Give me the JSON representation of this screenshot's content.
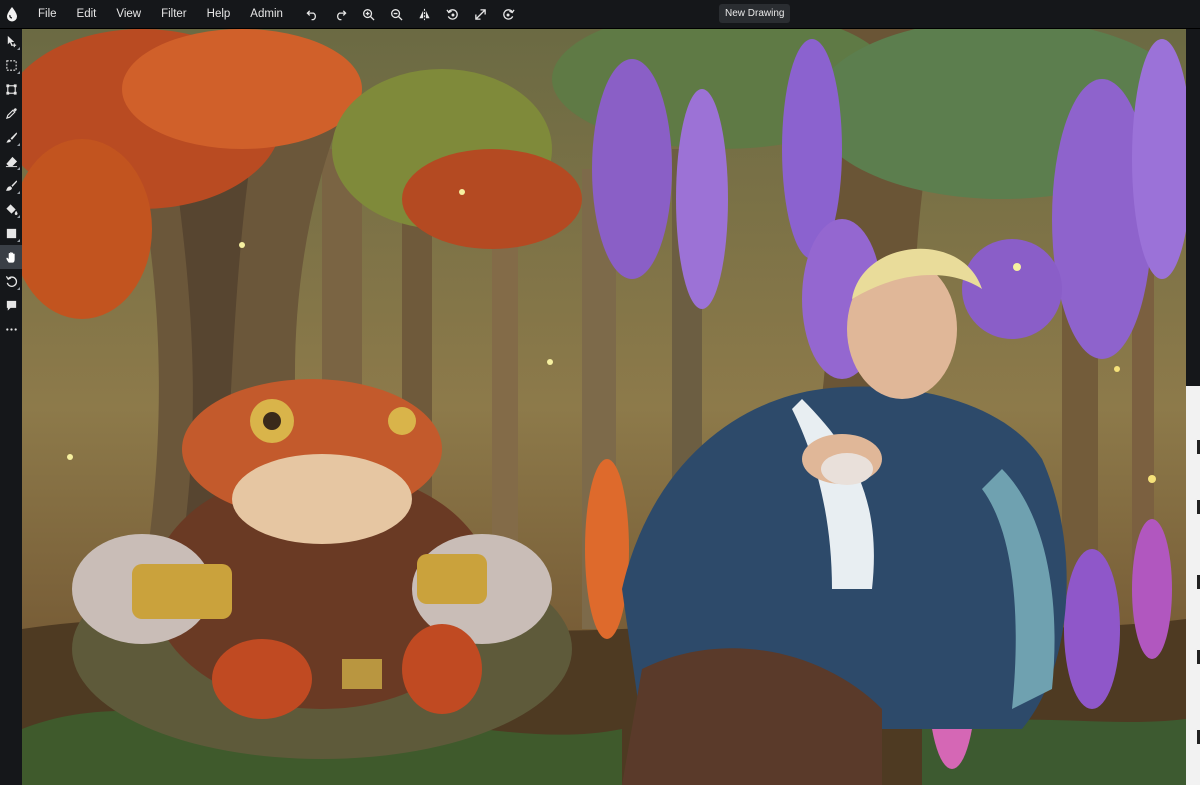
{
  "menubar": {
    "logo_icon": "drop-logo-icon",
    "menus": [
      {
        "label": "File"
      },
      {
        "label": "Edit"
      },
      {
        "label": "View"
      },
      {
        "label": "Filter"
      },
      {
        "label": "Help"
      },
      {
        "label": "Admin"
      }
    ],
    "quick_actions": [
      {
        "icon": "undo-icon"
      },
      {
        "icon": "redo-icon"
      },
      {
        "icon": "zoom-in-icon"
      },
      {
        "icon": "zoom-out-icon"
      },
      {
        "icon": "flip-icon"
      },
      {
        "icon": "rotate-icon"
      },
      {
        "icon": "fullscreen-icon"
      },
      {
        "icon": "reset-view-icon"
      }
    ],
    "document_title": "New Drawing"
  },
  "toolbar": {
    "tools": [
      {
        "name": "move-tool",
        "icon": "move-icon"
      },
      {
        "name": "select-tool",
        "icon": "marquee-icon"
      },
      {
        "name": "transform-tool",
        "icon": "transform-icon"
      },
      {
        "name": "eyedropper-tool",
        "icon": "eyedropper-icon"
      },
      {
        "name": "brush-tool",
        "icon": "brush-icon"
      },
      {
        "name": "eraser-tool",
        "icon": "eraser-icon"
      },
      {
        "name": "smudge-tool",
        "icon": "smudge-icon"
      },
      {
        "name": "fill-tool",
        "icon": "paint-bucket-icon"
      },
      {
        "name": "shape-tool",
        "icon": "rectangle-icon"
      },
      {
        "name": "hand-tool",
        "icon": "hand-icon",
        "active": true
      },
      {
        "name": "rotate-view-tool",
        "icon": "rotate-icon"
      },
      {
        "name": "comment-tool",
        "icon": "speech-bubble-icon"
      },
      {
        "name": "more-tools",
        "icon": "more-icon"
      }
    ]
  },
  "colors": {
    "chrome_bg": "#15171a",
    "active_tool_bg": "#3a3f46",
    "title_badge_bg": "#2a2d31",
    "text": "#e6e6e6"
  }
}
